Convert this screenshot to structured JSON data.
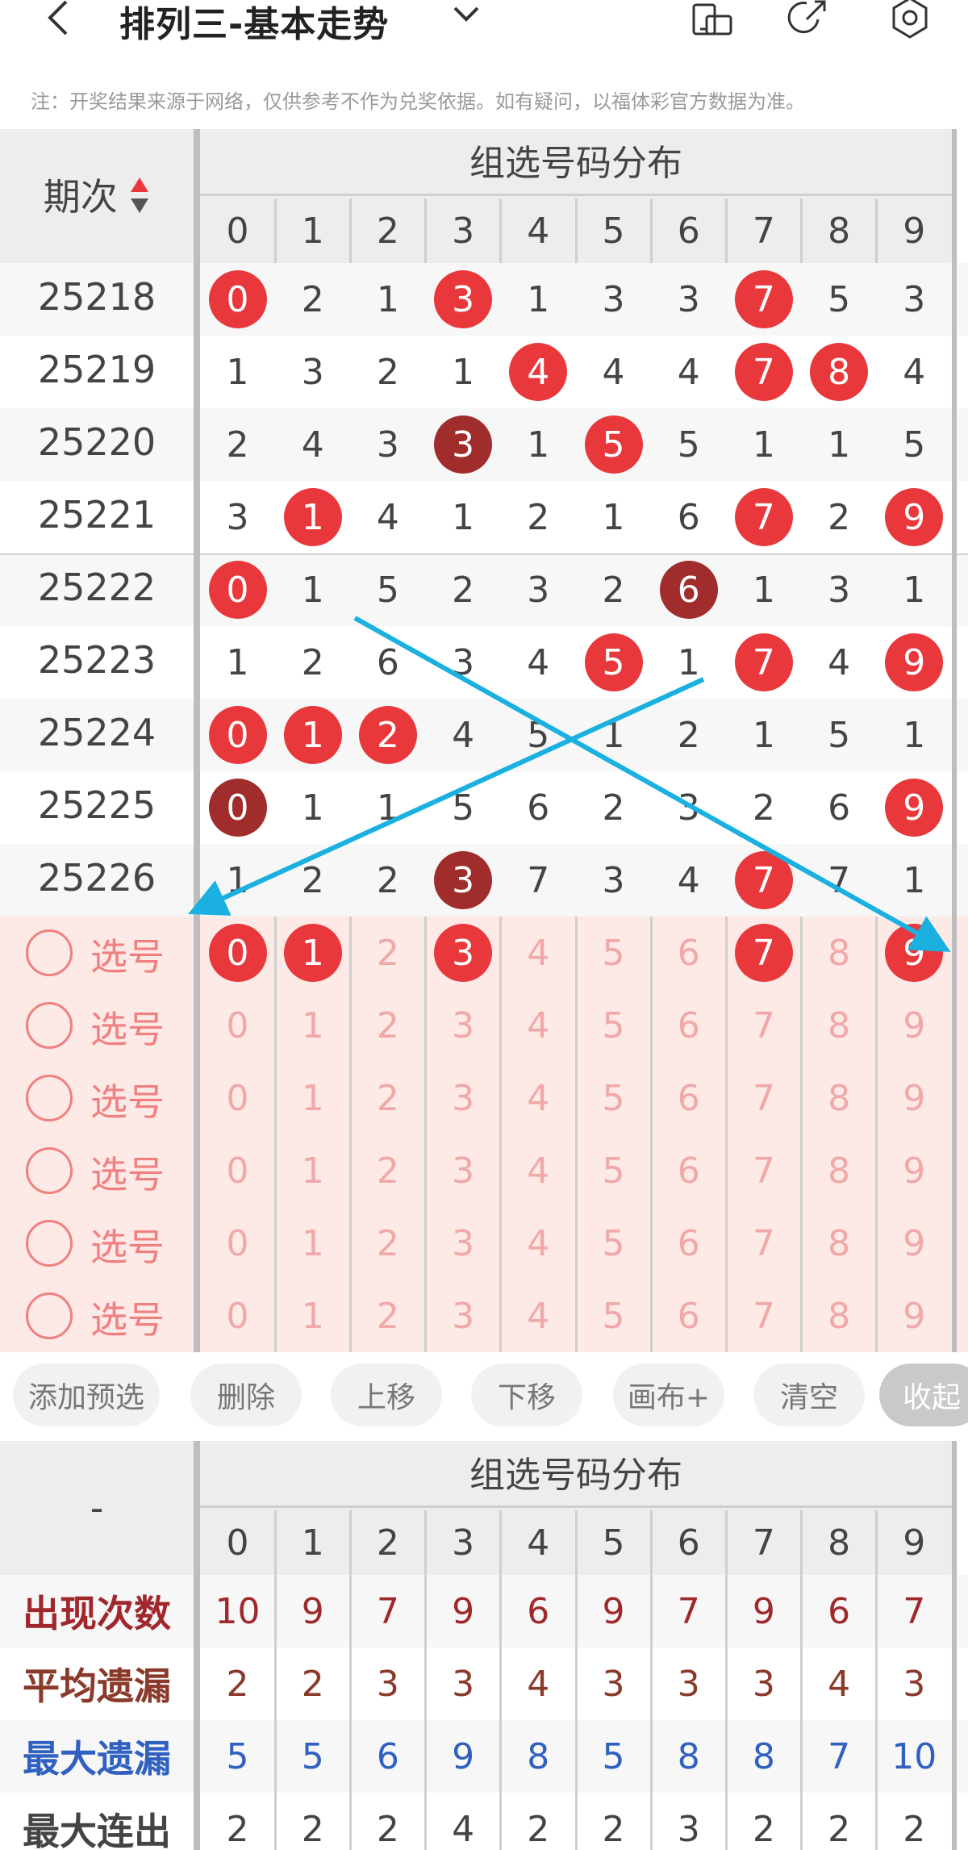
{
  "header": {
    "title": "排列三-基本走势",
    "back_icon": "back-arrow-icon",
    "dropdown_icon": "chevron-down-icon",
    "icons": [
      "phone-landscape-icon",
      "share-icon",
      "settings-icon"
    ]
  },
  "notice": "注：开奖结果来源于网络，仅供参考不作为兑奖依据。如有疑问，以福体彩官方数据为准。",
  "table": {
    "issue_header": "期次",
    "section_title": "组选号码分布",
    "columns": [
      "0",
      "1",
      "2",
      "3",
      "4",
      "5",
      "6",
      "7",
      "8",
      "9"
    ],
    "rows": [
      {
        "issue": "25218",
        "values": [
          "0",
          "2",
          "1",
          "3",
          "1",
          "3",
          "3",
          "7",
          "5",
          "3"
        ],
        "hits": [
          0,
          3,
          7
        ],
        "dark": []
      },
      {
        "issue": "25219",
        "values": [
          "1",
          "3",
          "2",
          "1",
          "4",
          "4",
          "4",
          "7",
          "8",
          "4"
        ],
        "hits": [
          4,
          7,
          8
        ],
        "dark": []
      },
      {
        "issue": "25220",
        "values": [
          "2",
          "4",
          "3",
          "3",
          "1",
          "5",
          "5",
          "1",
          "1",
          "5"
        ],
        "hits": [
          3,
          5
        ],
        "dark": [
          3
        ]
      },
      {
        "issue": "25221",
        "values": [
          "3",
          "1",
          "4",
          "1",
          "2",
          "1",
          "6",
          "7",
          "2",
          "9"
        ],
        "hits": [
          1,
          7,
          9
        ],
        "dark": []
      },
      {
        "issue": "25222",
        "values": [
          "0",
          "1",
          "5",
          "2",
          "3",
          "2",
          "6",
          "1",
          "3",
          "1"
        ],
        "hits": [
          0,
          6
        ],
        "dark": [
          6
        ]
      },
      {
        "issue": "25223",
        "values": [
          "1",
          "2",
          "6",
          "3",
          "4",
          "5",
          "1",
          "7",
          "4",
          "9"
        ],
        "hits": [
          5,
          7,
          9
        ],
        "dark": []
      },
      {
        "issue": "25224",
        "values": [
          "0",
          "1",
          "2",
          "4",
          "5",
          "1",
          "2",
          "1",
          "5",
          "1"
        ],
        "hits": [
          0,
          1,
          2
        ],
        "dark": []
      },
      {
        "issue": "25225",
        "values": [
          "0",
          "1",
          "1",
          "5",
          "6",
          "2",
          "3",
          "2",
          "6",
          "9"
        ],
        "hits": [
          0,
          9
        ],
        "dark": [
          0
        ]
      },
      {
        "issue": "25226",
        "values": [
          "1",
          "2",
          "2",
          "3",
          "7",
          "3",
          "4",
          "7",
          "7",
          "1"
        ],
        "hits": [
          3,
          7
        ],
        "dark": [
          3
        ]
      }
    ],
    "pick_label": "选号",
    "pick_rows": [
      {
        "values": [
          "0",
          "1",
          "2",
          "3",
          "4",
          "5",
          "6",
          "7",
          "8",
          "9"
        ],
        "hits": [
          0,
          1,
          3,
          7,
          9
        ]
      },
      {
        "values": [
          "0",
          "1",
          "2",
          "3",
          "4",
          "5",
          "6",
          "7",
          "8",
          "9"
        ],
        "hits": []
      },
      {
        "values": [
          "0",
          "1",
          "2",
          "3",
          "4",
          "5",
          "6",
          "7",
          "8",
          "9"
        ],
        "hits": []
      },
      {
        "values": [
          "0",
          "1",
          "2",
          "3",
          "4",
          "5",
          "6",
          "7",
          "8",
          "9"
        ],
        "hits": []
      },
      {
        "values": [
          "0",
          "1",
          "2",
          "3",
          "4",
          "5",
          "6",
          "7",
          "8",
          "9"
        ],
        "hits": []
      },
      {
        "values": [
          "0",
          "1",
          "2",
          "3",
          "4",
          "5",
          "6",
          "7",
          "8",
          "9"
        ],
        "hits": []
      }
    ]
  },
  "buttons": [
    "添加预选",
    "删除",
    "上移",
    "下移",
    "画布+",
    "清空",
    "收起"
  ],
  "stats": {
    "corner": "-",
    "section_title": "组选号码分布",
    "columns": [
      "0",
      "1",
      "2",
      "3",
      "4",
      "5",
      "6",
      "7",
      "8",
      "9"
    ],
    "rows": [
      {
        "label": "出现次数",
        "values": [
          "10",
          "9",
          "7",
          "9",
          "6",
          "9",
          "7",
          "9",
          "6",
          "7"
        ],
        "color": "#a0282c"
      },
      {
        "label": "平均遗漏",
        "values": [
          "2",
          "2",
          "3",
          "3",
          "4",
          "3",
          "3",
          "3",
          "4",
          "3"
        ],
        "color": "#8a3a2a"
      },
      {
        "label": "最大遗漏",
        "values": [
          "5",
          "5",
          "6",
          "9",
          "8",
          "5",
          "8",
          "8",
          "7",
          "10"
        ],
        "color": "#3060c0"
      },
      {
        "label": "最大连出",
        "values": [
          "2",
          "2",
          "2",
          "4",
          "2",
          "2",
          "3",
          "2",
          "2",
          "2"
        ],
        "color": "#444444"
      }
    ]
  },
  "colors": {
    "ball": "#e8383b",
    "ball_dark": "#a02c2c",
    "arrow": "#1ab0e0",
    "pick_bg": "#fde9e6"
  }
}
